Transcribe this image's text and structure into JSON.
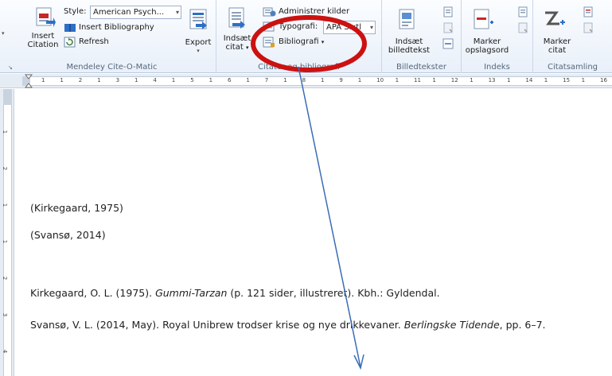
{
  "ribbon": {
    "mendeley": {
      "style_label": "Style:",
      "style_value": "American Psych...",
      "insert_bibliography": "Insert Bibliography",
      "refresh": "Refresh",
      "insert_citation_line1": "Insert",
      "insert_citation_line2": "Citation",
      "export": "Export",
      "group_label": "Mendeley Cite-O-Matic"
    },
    "citations": {
      "insert_line1": "Indsæt",
      "insert_line2": "citat",
      "manage_sources": "Administrer kilder",
      "typography_label": "Typografi:",
      "typography_value": "APA Sixtl",
      "bibliography": "Bibliografi",
      "group_label": "Citater og bibliografi"
    },
    "captions": {
      "insert_line1": "Indsæt",
      "insert_line2": "billedtekst",
      "group_label": "Billedtekster"
    },
    "index": {
      "mark_line1": "Marker",
      "mark_line2": "opslagsord",
      "group_label": "Indeks"
    },
    "table_of_auth": {
      "mark_line1": "Marker",
      "mark_line2": "citat",
      "group_label": "Citatsamling"
    }
  },
  "ruler": {
    "tab_symbol": "L",
    "h_numbers": [
      "1",
      "1",
      "2",
      "1",
      "3",
      "1",
      "4",
      "1",
      "5",
      "1",
      "6",
      "1",
      "7",
      "1",
      "8",
      "1",
      "9",
      "1",
      "10",
      "1",
      "11",
      "1",
      "12",
      "1",
      "13",
      "1",
      "14",
      "1",
      "15",
      "1",
      "16"
    ],
    "v_numbers": [
      "1",
      "2",
      "1",
      "1",
      "2",
      "3",
      "4"
    ]
  },
  "document": {
    "cite1": "(Kirkegaard, 1975)",
    "cite2": "(Svansø, 2014)",
    "ref1_pre": "Kirkegaard, O. L. (1975). ",
    "ref1_title": "Gummi-Tarzan",
    "ref1_post": " (p. 121 sider, illustreret). Kbh.: Gyldendal.",
    "ref2_pre": "Svansø, V. L. (2014, May). Royal Unibrew trodser krise og nye drikkevaner. ",
    "ref2_title": "Berlingske Tidende",
    "ref2_post": ", pp. 6–7."
  },
  "colors": {
    "annotation_circle": "#cc1111",
    "annotation_arrow": "#3a6db5",
    "ribbon_bg": "#eaf1fa"
  }
}
